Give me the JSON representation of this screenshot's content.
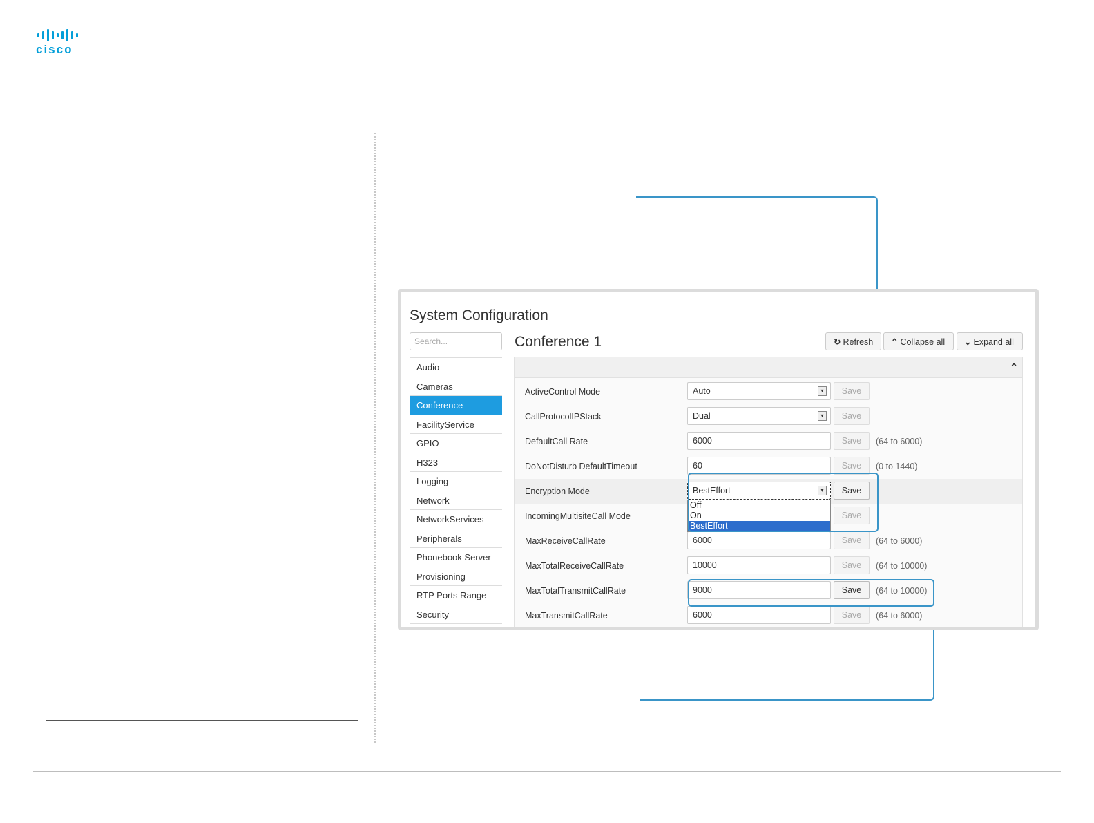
{
  "logo": {
    "text": "cisco"
  },
  "panel": {
    "title": "System Configuration",
    "search_placeholder": "Search...",
    "nav": [
      {
        "label": "Audio"
      },
      {
        "label": "Cameras"
      },
      {
        "label": "Conference",
        "active": true
      },
      {
        "label": "FacilityService"
      },
      {
        "label": "GPIO"
      },
      {
        "label": "H323"
      },
      {
        "label": "Logging"
      },
      {
        "label": "Network"
      },
      {
        "label": "NetworkServices"
      },
      {
        "label": "Peripherals"
      },
      {
        "label": "Phonebook Server"
      },
      {
        "label": "Provisioning"
      },
      {
        "label": "RTP Ports Range"
      },
      {
        "label": "Security"
      }
    ],
    "section_title": "Conference 1",
    "buttons": {
      "refresh": "Refresh",
      "collapse": "Collapse all",
      "expand": "Expand all"
    },
    "rows": [
      {
        "label": "ActiveControl Mode",
        "value": "Auto",
        "save": "Save",
        "range": ""
      },
      {
        "label": "CallProtocolIPStack",
        "value": "Dual",
        "save": "Save",
        "range": ""
      },
      {
        "label": "DefaultCall Rate",
        "value": "6000",
        "save": "Save",
        "range": "(64 to 6000)"
      },
      {
        "label": "DoNotDisturb DefaultTimeout",
        "value": "60",
        "save": "Save",
        "range": "(0 to 1440)"
      },
      {
        "label": "Encryption Mode",
        "value": "BestEffort",
        "save": "Save",
        "range": ""
      },
      {
        "label": "IncomingMultisiteCall Mode",
        "value": "",
        "save": "Save",
        "range": ""
      },
      {
        "label": "MaxReceiveCallRate",
        "value": "6000",
        "save": "Save",
        "range": "(64 to 6000)"
      },
      {
        "label": "MaxTotalReceiveCallRate",
        "value": "10000",
        "save": "Save",
        "range": "(64 to 10000)"
      },
      {
        "label": "MaxTotalTransmitCallRate",
        "value": "9000",
        "save": "Save",
        "range": "(64 to 10000)"
      },
      {
        "label": "MaxTransmitCallRate",
        "value": "6000",
        "save": "Save",
        "range": "(64 to 6000)"
      }
    ],
    "encryption_options": [
      "Off",
      "On",
      "BestEffort"
    ],
    "encryption_selected": "BestEffort"
  },
  "colors": {
    "accent": "#1e9ce0",
    "callout": "#3a95c8",
    "brand": "#049fd9"
  }
}
